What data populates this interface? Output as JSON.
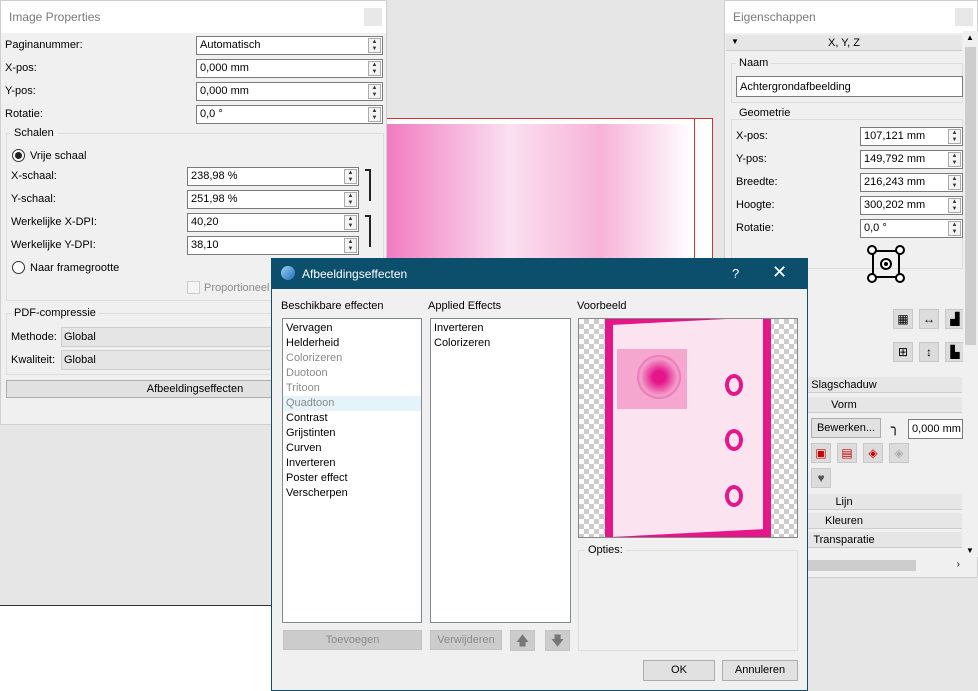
{
  "image_properties": {
    "title": "Image Properties",
    "rows": [
      {
        "label": "Paginanummer:",
        "value": "Automatisch"
      },
      {
        "label": "X-pos:",
        "value": "0,000 mm"
      },
      {
        "label": "Y-pos:",
        "value": "0,000 mm"
      },
      {
        "label": "Rotatie:",
        "value": "0,0 °"
      }
    ],
    "scale_group": "Schalen",
    "free_scale": "Vrije schaal",
    "scale_rows": [
      {
        "label": "X-schaal:",
        "value": "238,98 %"
      },
      {
        "label": "Y-schaal:",
        "value": "251,98 %"
      },
      {
        "label": "Werkelijke X-DPI:",
        "value": "40,20"
      },
      {
        "label": "Werkelijke Y-DPI:",
        "value": "38,10"
      }
    ],
    "frame_size": "Naar framegrootte",
    "proportional": "Proportioneel",
    "pdf_group": "PDF-compressie",
    "method_label": "Methode:",
    "method_value": "Global",
    "quality_label": "Kwaliteit:",
    "quality_value": "Global",
    "effects_button": "Afbeeldingseffecten"
  },
  "properties": {
    "title": "Eigenschappen",
    "section_xyz": "X, Y, Z",
    "name_group": "Naam",
    "name_value": "Achtergrondafbeelding",
    "geometry_group": "Geometrie",
    "rows": [
      {
        "label": "X-pos:",
        "value": "107,121 mm"
      },
      {
        "label": "Y-pos:",
        "value": "149,792 mm"
      },
      {
        "label": "Breedte:",
        "value": "216,243 mm"
      },
      {
        "label": "Hoogte:",
        "value": "300,202 mm"
      },
      {
        "label": "Rotatie:",
        "value": "0,0 °"
      }
    ],
    "section_shadow": "Slagschaduw",
    "section_shape": "Vorm",
    "edit_button": "Bewerken...",
    "corner_value": "0,000 mm",
    "section_line": "Lijn",
    "section_colors": "Kleuren",
    "section_transparency": "Transparatie"
  },
  "dialog": {
    "title": "Afbeeldingseffecten",
    "help": "?",
    "available_label": "Beschikbare effecten",
    "available": [
      {
        "text": "Vervagen",
        "state": "normal"
      },
      {
        "text": "Helderheid",
        "state": "normal"
      },
      {
        "text": "Colorizeren",
        "state": "disabled"
      },
      {
        "text": "Duotoon",
        "state": "disabled"
      },
      {
        "text": "Tritoon",
        "state": "disabled"
      },
      {
        "text": "Quadtoon",
        "state": "hover"
      },
      {
        "text": "Contrast",
        "state": "normal"
      },
      {
        "text": "Grijstinten",
        "state": "normal"
      },
      {
        "text": "Curven",
        "state": "normal"
      },
      {
        "text": "Inverteren",
        "state": "normal"
      },
      {
        "text": "Poster effect",
        "state": "normal"
      },
      {
        "text": "Verscherpen",
        "state": "normal"
      }
    ],
    "applied_label": "Applied Effects",
    "applied": [
      "Inverteren",
      "Colorizeren"
    ],
    "preview_label": "Voorbeeld",
    "options_label": "Opties:",
    "add_button": "Toevoegen",
    "remove_button": "Verwijderen",
    "ok_button": "OK",
    "cancel_button": "Annuleren",
    "title_color": "#0b4f6c",
    "accent_pink": "#e5168a"
  }
}
